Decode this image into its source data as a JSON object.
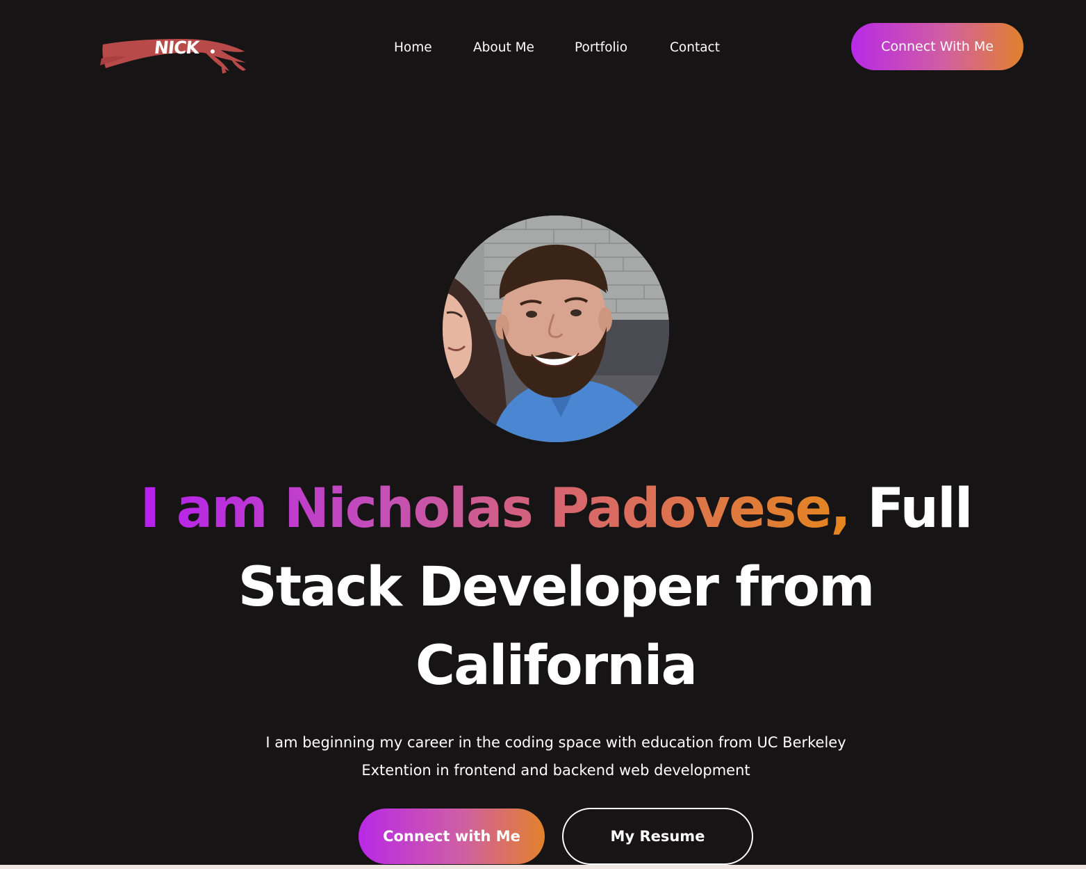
{
  "header": {
    "logo_text": "NICK",
    "nav": [
      {
        "label": "Home"
      },
      {
        "label": "About Me"
      },
      {
        "label": "Portfolio"
      },
      {
        "label": "Contact"
      }
    ],
    "cta_label": "Connect With Me"
  },
  "hero": {
    "headline_gradient": "I am Nicholas Padovese,",
    "headline_rest": "Full Stack Developer from California",
    "intro_line1": "I am beginning my career in the coding space with education from UC Berkeley",
    "intro_line2": "Extention in frontend and backend web development",
    "primary_button": "Connect with Me",
    "secondary_button": "My Resume"
  },
  "colors": {
    "background": "#161414",
    "gradient_start": "#b620ef",
    "gradient_end": "#e4861e",
    "logo_brush": "#b84a4a",
    "text": "#ffffff"
  },
  "icons": {
    "logo": "brush-stroke-logo"
  }
}
